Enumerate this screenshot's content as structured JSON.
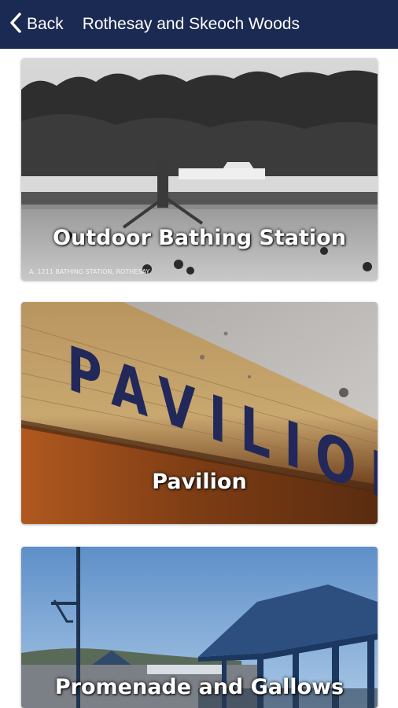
{
  "header": {
    "back_label": "Back",
    "title": "Rothesay and Skeoch Woods"
  },
  "cards": [
    {
      "label": "Outdoor Bathing Station",
      "caption": "A. 1211  BATHING STATION, ROTHESAY."
    },
    {
      "label": "Pavilion",
      "sign_text": "PAVILION"
    },
    {
      "label": "Promenade and Gallows"
    }
  ],
  "colors": {
    "header_bg": "#1b2a52",
    "header_text": "#ffffff"
  },
  "icons": {
    "back": "chevron-left-icon"
  }
}
